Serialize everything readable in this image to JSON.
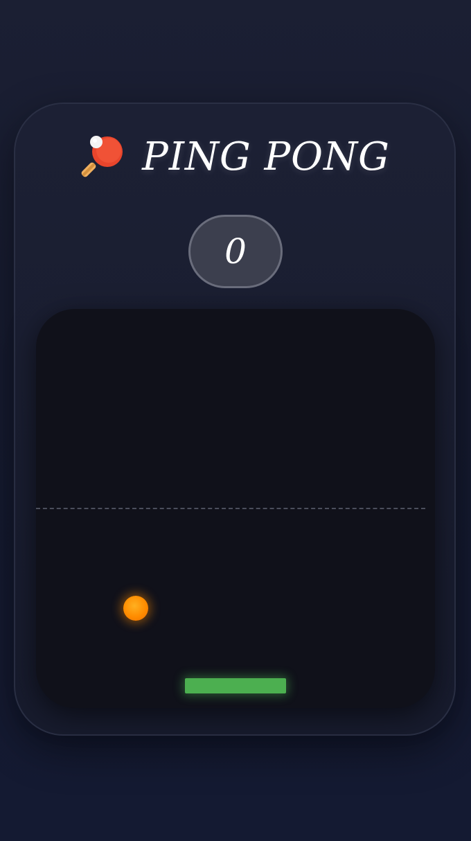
{
  "game": {
    "title": "PING PONG",
    "title_icon": "ping-pong-paddle-icon",
    "score": "0"
  },
  "colors": {
    "ball": "#ff8c00",
    "paddle": "#4caf50",
    "court": "#10111a",
    "background": "#161b30"
  }
}
